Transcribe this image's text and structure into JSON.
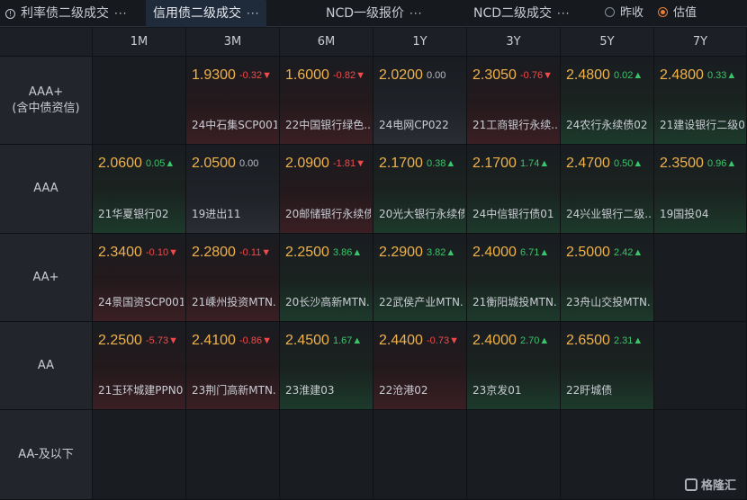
{
  "tabs": [
    {
      "label": "利率债二级成交",
      "dots": "···"
    },
    {
      "label": "信用债二级成交",
      "dots": "···"
    },
    {
      "label": "NCD一级报价",
      "dots": "···"
    },
    {
      "label": "NCD二级成交",
      "dots": "···"
    }
  ],
  "radios": [
    {
      "label": "昨收",
      "selected": false
    },
    {
      "label": "估值",
      "selected": true
    }
  ],
  "columns": [
    "1M",
    "3M",
    "6M",
    "1Y",
    "3Y",
    "5Y",
    "7Y"
  ],
  "rows": [
    {
      "label": "AAA+",
      "sublabel": "(含中债资信)"
    },
    {
      "label": "AAA",
      "sublabel": ""
    },
    {
      "label": "AA+",
      "sublabel": ""
    },
    {
      "label": "AA",
      "sublabel": ""
    },
    {
      "label": "AA-及以下",
      "sublabel": ""
    }
  ],
  "cells": [
    [
      null,
      {
        "yield": "1.9300",
        "change": "-0.32▼",
        "dir": "down",
        "bond": "24中石集SCP001"
      },
      {
        "yield": "1.6000",
        "change": "-0.82▼",
        "dir": "down",
        "bond": "22中国银行绿色..."
      },
      {
        "yield": "2.0200",
        "change": "0.00",
        "dir": "flat",
        "bond": "24电网CP022"
      },
      {
        "yield": "2.3050",
        "change": "-0.76▼",
        "dir": "down",
        "bond": "21工商银行永续..."
      },
      {
        "yield": "2.4800",
        "change": "0.02▲",
        "dir": "up",
        "bond": "24农行永续债02"
      },
      {
        "yield": "2.4800",
        "change": "0.33▲",
        "dir": "up",
        "bond": "21建设银行二级0"
      }
    ],
    [
      {
        "yield": "2.0600",
        "change": "0.05▲",
        "dir": "up",
        "bond": "21华夏银行02"
      },
      {
        "yield": "2.0500",
        "change": "0.00",
        "dir": "flat",
        "bond": "19进出11"
      },
      {
        "yield": "2.0900",
        "change": "-1.81▼",
        "dir": "down",
        "bond": "20邮储银行永续债"
      },
      {
        "yield": "2.1700",
        "change": "0.38▲",
        "dir": "up",
        "bond": "20光大银行永续债"
      },
      {
        "yield": "2.1700",
        "change": "1.74▲",
        "dir": "up",
        "bond": "24中信银行债01"
      },
      {
        "yield": "2.4700",
        "change": "0.50▲",
        "dir": "up",
        "bond": "24兴业银行二级..."
      },
      {
        "yield": "2.3500",
        "change": "0.96▲",
        "dir": "up",
        "bond": "19国投04"
      }
    ],
    [
      {
        "yield": "2.3400",
        "change": "-0.10▼",
        "dir": "down",
        "bond": "24景国资SCP001"
      },
      {
        "yield": "2.2800",
        "change": "-0.11▼",
        "dir": "down",
        "bond": "21嵊州投资MTN."
      },
      {
        "yield": "2.2500",
        "change": "3.86▲",
        "dir": "up",
        "bond": "20长沙高新MTN."
      },
      {
        "yield": "2.2900",
        "change": "3.82▲",
        "dir": "up",
        "bond": "22武侯产业MTN."
      },
      {
        "yield": "2.4000",
        "change": "6.71▲",
        "dir": "up",
        "bond": "21衡阳城投MTN."
      },
      {
        "yield": "2.5000",
        "change": "2.42▲",
        "dir": "up",
        "bond": "23舟山交投MTN."
      },
      null
    ],
    [
      {
        "yield": "2.2500",
        "change": "-5.73▼",
        "dir": "down",
        "bond": "21玉环城建PPN0"
      },
      {
        "yield": "2.4100",
        "change": "-0.86▼",
        "dir": "down",
        "bond": "23荆门高新MTN."
      },
      {
        "yield": "2.4500",
        "change": "1.67▲",
        "dir": "up",
        "bond": "23淮建03"
      },
      {
        "yield": "2.4400",
        "change": "-0.73▼",
        "dir": "down",
        "bond": "22沧港02"
      },
      {
        "yield": "2.4000",
        "change": "2.70▲",
        "dir": "up",
        "bond": "23京发01"
      },
      {
        "yield": "2.6500",
        "change": "2.31▲",
        "dir": "up",
        "bond": "22盱城债"
      },
      null
    ],
    [
      null,
      null,
      null,
      null,
      null,
      null,
      null
    ]
  ],
  "watermark": "格隆汇",
  "colors": {
    "yield": "#f0b24a",
    "up": "#3cc46a",
    "down": "#f04a4a",
    "radio_on": "#e9803a"
  }
}
